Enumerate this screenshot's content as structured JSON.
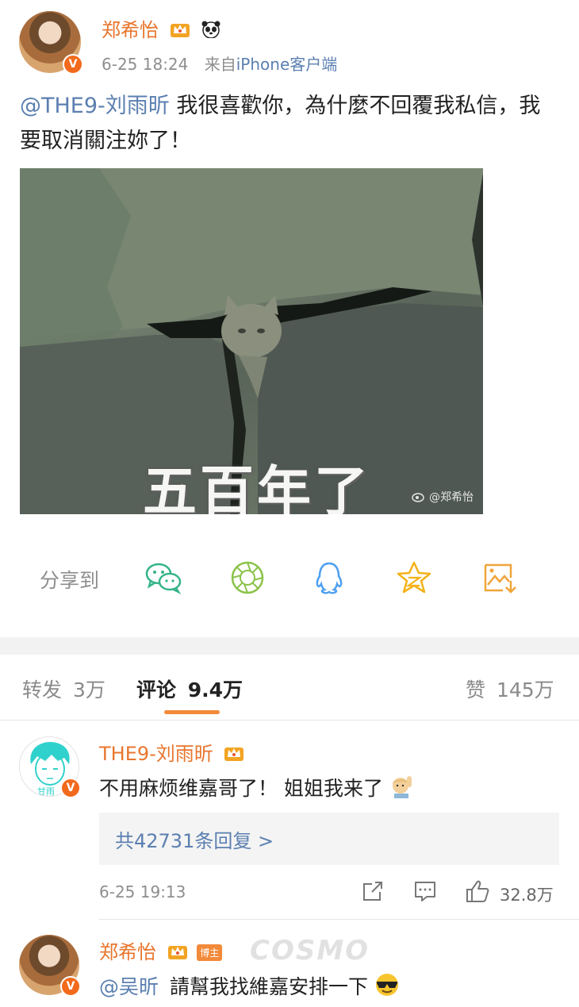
{
  "post": {
    "username": "郑希怡",
    "timestamp": "6-25 18:24",
    "source_prefix": "来自",
    "source": "iPhone客户端",
    "mention": "@THE9-刘雨昕",
    "text": "我很喜歡你，為什麼不回覆我私信，我要取消關注妳了！",
    "image_caption": "五百年了",
    "image_watermark": "@郑希怡"
  },
  "share": {
    "label": "分享到",
    "targets": [
      "wechat-icon",
      "moments-icon",
      "qq-icon",
      "qzone-icon",
      "save-image-icon"
    ]
  },
  "tabs": {
    "repost_label": "转发",
    "repost_count": "3万",
    "comment_label": "评论",
    "comment_count": "9.4万",
    "like_label": "赞",
    "like_count": "145万"
  },
  "comments": [
    {
      "username": "THE9-刘雨昕",
      "text": "不用麻烦维嘉哥了！ 姐姐我来了",
      "replies": "共42731条回复 >",
      "time": "6-25 19:13",
      "likes": "32.8万"
    },
    {
      "username": "郑希怡",
      "author_tag": "博主",
      "mention": "@吴昕",
      "text": "請幫我找維嘉安排一下"
    }
  ],
  "watermark": "COSMO",
  "colors": {
    "username": "#e8762d",
    "link": "#5b7fb0",
    "accent": "#f28a3a",
    "verified": "#f26a1b"
  }
}
